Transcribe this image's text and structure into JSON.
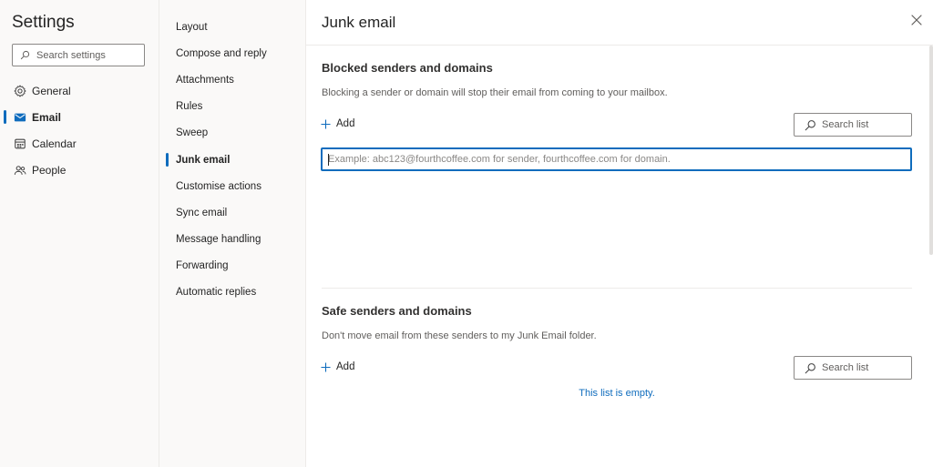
{
  "settings": {
    "title": "Settings",
    "search_placeholder": "Search settings"
  },
  "nav": [
    {
      "label": "General",
      "icon": "gear-icon"
    },
    {
      "label": "Email",
      "icon": "mail-icon",
      "active": true
    },
    {
      "label": "Calendar",
      "icon": "calendar-icon"
    },
    {
      "label": "People",
      "icon": "people-icon"
    }
  ],
  "categories": [
    {
      "label": "Layout"
    },
    {
      "label": "Compose and reply"
    },
    {
      "label": "Attachments"
    },
    {
      "label": "Rules"
    },
    {
      "label": "Sweep"
    },
    {
      "label": "Junk email",
      "active": true
    },
    {
      "label": "Customise actions"
    },
    {
      "label": "Sync email"
    },
    {
      "label": "Message handling"
    },
    {
      "label": "Forwarding"
    },
    {
      "label": "Automatic replies"
    }
  ],
  "page": {
    "title": "Junk email"
  },
  "blocked": {
    "title": "Blocked senders and domains",
    "description": "Blocking a sender or domain will stop their email from coming to your mailbox.",
    "add_label": "Add",
    "search_placeholder": "Search list",
    "input_placeholder": "Example: abc123@fourthcoffee.com for sender, fourthcoffee.com for domain."
  },
  "safe": {
    "title": "Safe senders and domains",
    "description": "Don't move email from these senders to my Junk Email folder.",
    "add_label": "Add",
    "search_placeholder": "Search list",
    "empty_text": "This list is empty."
  },
  "colors": {
    "accent": "#0f6cbd",
    "pane_bg": "#faf9f8",
    "divider": "#edebe9"
  }
}
